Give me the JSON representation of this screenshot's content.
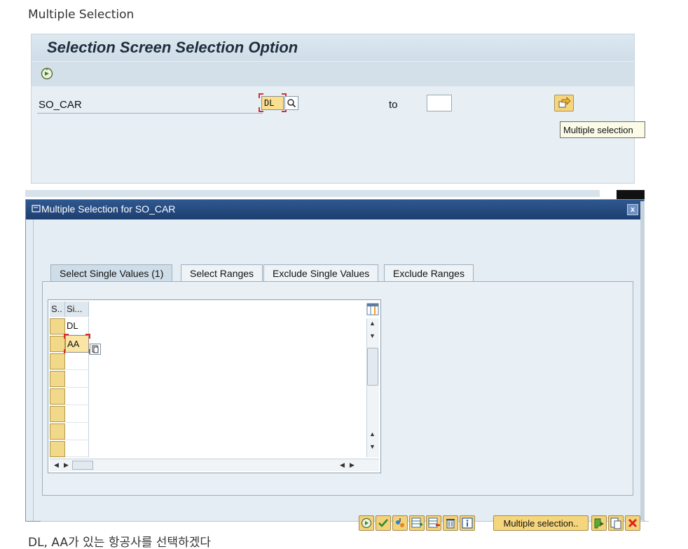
{
  "captions": {
    "top": "Multiple Selection",
    "bottom": "DL, AA가 있는 항공사를 선택하겠다"
  },
  "selection_screen": {
    "title": "Selection Screen Selection Option",
    "execute_icon": "execute-icon",
    "field_label": "SO_CAR",
    "low_value": "DL",
    "to_label": "to",
    "high_value": "",
    "multi_button_icon": "arrow-right-icon",
    "tooltip": "Multiple selection"
  },
  "dialog": {
    "title": "Multiple Selection for SO_CAR",
    "close_label": "x",
    "tabs": [
      {
        "label": "Select Single Values (1)",
        "active": true
      },
      {
        "label": "Select Ranges",
        "active": false
      },
      {
        "label": "Exclude Single Values",
        "active": false
      },
      {
        "label": "Exclude Ranges",
        "active": false
      }
    ],
    "table": {
      "col_sel_header": "S..",
      "col_value_header": "Si...",
      "rows": [
        "DL",
        "AA",
        "",
        "",
        "",
        "",
        "",
        ""
      ]
    },
    "footer": {
      "multi_selection_label": "Multiple selection..",
      "buttons": [
        "execute-icon",
        "check-icon",
        "import-icon",
        "insert-line-icon",
        "delete-line-icon",
        "trash-icon",
        "info-icon"
      ],
      "right_buttons": [
        "copy-icon",
        "paste-icon",
        "cancel-icon"
      ]
    }
  },
  "colors": {
    "sap_bg": "#e7eff5",
    "dialog_title": "#2f5891",
    "button_yellow": "#f6d67c",
    "input_highlight": "#f9df8f"
  }
}
